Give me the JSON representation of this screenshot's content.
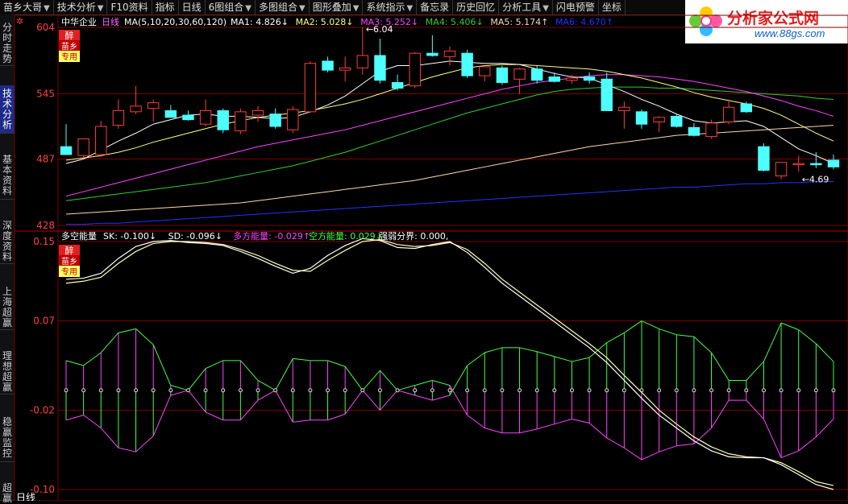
{
  "menu": [
    "苗乡大哥",
    "技术分析",
    "F10资料",
    "指标",
    "日线",
    "6图组合",
    "多图组合",
    "图形叠加",
    "系统指示",
    "备忘录",
    "历史回忆",
    "分析工具",
    "闪电预警",
    "坐标"
  ],
  "menu_arrows": [
    true,
    true,
    false,
    false,
    false,
    true,
    true,
    true,
    true,
    false,
    false,
    true,
    false,
    false
  ],
  "logo": {
    "brand": "分析家公式网",
    "url": "www.88gs.com"
  },
  "sidebar": [
    {
      "label": "分时走势",
      "active": false
    },
    {
      "label": "技术分析",
      "active": true
    },
    {
      "label": "基本资料",
      "active": false
    },
    {
      "label": "深度资料",
      "active": false
    },
    {
      "label": "上海超赢",
      "active": false
    },
    {
      "label": "理想超赢",
      "active": false
    },
    {
      "label": "稳赢监控",
      "active": false
    },
    {
      "label": "超赢",
      "active": false
    }
  ],
  "status_text": "日线",
  "badge": {
    "line1": "醉",
    "line2": "苗乡",
    "line3": "专用"
  },
  "colors": {
    "up": "#ff3c3c",
    "down": "#4dffff",
    "ma1": "#ffffff",
    "ma2": "#ffff80",
    "ma3": "#ff44ff",
    "ma4": "#33cc33",
    "ma5": "#ffd8b0",
    "ma6": "#2233ff",
    "pink": "#ff44ff",
    "green": "#44ff44",
    "grid": "#7a0000"
  },
  "chart_data": [
    {
      "type": "candlestick",
      "title": "中华企业",
      "period": "日线",
      "indicator_label": "MA(5,10,20,30,60,120)",
      "legend": [
        {
          "text": "MA1: 4.826",
          "arrow": "↓",
          "color": "ma1"
        },
        {
          "text": "MA2: 5.028",
          "arrow": "↓",
          "color": "ma2"
        },
        {
          "text": "MA3: 5.252",
          "arrow": "↓",
          "color": "ma3"
        },
        {
          "text": "MA4: 5.406",
          "arrow": "↓",
          "color": "ma4"
        },
        {
          "text": "MA5: 5.174",
          "arrow": "↑",
          "color": "ma5"
        },
        {
          "text": "MA6: 4.670",
          "arrow": "↑",
          "color": "ma6"
        }
      ],
      "y_ticks": [
        "604",
        "545",
        "487",
        "428"
      ],
      "y_values": [
        6.04,
        5.45,
        4.87,
        4.28
      ],
      "ylim": [
        4.28,
        6.04
      ],
      "annotations": [
        {
          "text": "6.04",
          "x": 17,
          "y": 6.04
        },
        {
          "text": "4.69",
          "x": 42,
          "y": 4.69
        }
      ],
      "candles": [
        {
          "o": 4.98,
          "h": 5.18,
          "l": 4.93,
          "c": 4.91
        },
        {
          "o": 4.9,
          "h": 5.03,
          "l": 4.88,
          "c": 5.05
        },
        {
          "o": 4.91,
          "h": 5.21,
          "l": 4.89,
          "c": 5.16
        },
        {
          "o": 5.17,
          "h": 5.4,
          "l": 5.14,
          "c": 5.3
        },
        {
          "o": 5.29,
          "h": 5.52,
          "l": 5.27,
          "c": 5.34
        },
        {
          "o": 5.32,
          "h": 5.4,
          "l": 5.2,
          "c": 5.37
        },
        {
          "o": 5.3,
          "h": 5.35,
          "l": 5.24,
          "c": 5.24
        },
        {
          "o": 5.26,
          "h": 5.3,
          "l": 5.21,
          "c": 5.22
        },
        {
          "o": 5.18,
          "h": 5.4,
          "l": 5.16,
          "c": 5.3
        },
        {
          "o": 5.3,
          "h": 5.32,
          "l": 5.1,
          "c": 5.13
        },
        {
          "o": 5.12,
          "h": 5.32,
          "l": 5.09,
          "c": 5.29
        },
        {
          "o": 5.26,
          "h": 5.34,
          "l": 5.2,
          "c": 5.3
        },
        {
          "o": 5.27,
          "h": 5.32,
          "l": 5.14,
          "c": 5.16
        },
        {
          "o": 5.13,
          "h": 5.34,
          "l": 5.1,
          "c": 5.31
        },
        {
          "o": 5.29,
          "h": 5.74,
          "l": 5.28,
          "c": 5.72
        },
        {
          "o": 5.74,
          "h": 5.78,
          "l": 5.64,
          "c": 5.66
        },
        {
          "o": 5.66,
          "h": 5.78,
          "l": 5.56,
          "c": 5.68
        },
        {
          "o": 5.68,
          "h": 6.04,
          "l": 5.62,
          "c": 5.79
        },
        {
          "o": 5.79,
          "h": 5.94,
          "l": 5.54,
          "c": 5.57
        },
        {
          "o": 5.55,
          "h": 5.62,
          "l": 5.48,
          "c": 5.5
        },
        {
          "o": 5.52,
          "h": 5.82,
          "l": 5.5,
          "c": 5.81
        },
        {
          "o": 5.81,
          "h": 5.97,
          "l": 5.78,
          "c": 5.79
        },
        {
          "o": 5.78,
          "h": 5.87,
          "l": 5.7,
          "c": 5.83
        },
        {
          "o": 5.81,
          "h": 5.84,
          "l": 5.59,
          "c": 5.61
        },
        {
          "o": 5.61,
          "h": 5.7,
          "l": 5.56,
          "c": 5.69
        },
        {
          "o": 5.68,
          "h": 5.7,
          "l": 5.53,
          "c": 5.55
        },
        {
          "o": 5.58,
          "h": 5.68,
          "l": 5.45,
          "c": 5.67
        },
        {
          "o": 5.67,
          "h": 5.7,
          "l": 5.54,
          "c": 5.57
        },
        {
          "o": 5.6,
          "h": 5.64,
          "l": 5.55,
          "c": 5.56
        },
        {
          "o": 5.57,
          "h": 5.62,
          "l": 5.54,
          "c": 5.59
        },
        {
          "o": 5.6,
          "h": 5.64,
          "l": 5.54,
          "c": 5.57
        },
        {
          "o": 5.58,
          "h": 5.64,
          "l": 5.34,
          "c": 5.3
        },
        {
          "o": 5.3,
          "h": 5.38,
          "l": 5.14,
          "c": 5.33
        },
        {
          "o": 5.29,
          "h": 5.31,
          "l": 5.14,
          "c": 5.18
        },
        {
          "o": 5.2,
          "h": 5.25,
          "l": 5.11,
          "c": 5.24
        },
        {
          "o": 5.25,
          "h": 5.27,
          "l": 5.15,
          "c": 5.16
        },
        {
          "o": 5.15,
          "h": 5.19,
          "l": 5.07,
          "c": 5.08
        },
        {
          "o": 5.07,
          "h": 5.22,
          "l": 5.05,
          "c": 5.19
        },
        {
          "o": 5.2,
          "h": 5.4,
          "l": 5.18,
          "c": 5.33
        },
        {
          "o": 5.36,
          "h": 5.38,
          "l": 5.28,
          "c": 5.29
        },
        {
          "o": 4.98,
          "h": 5.01,
          "l": 4.76,
          "c": 4.77
        },
        {
          "o": 4.72,
          "h": 4.83,
          "l": 4.69,
          "c": 4.84
        },
        {
          "o": 4.82,
          "h": 4.9,
          "l": 4.76,
          "c": 4.83
        },
        {
          "o": 4.83,
          "h": 4.93,
          "l": 4.79,
          "c": 4.82
        },
        {
          "o": 4.86,
          "h": 4.91,
          "l": 4.78,
          "c": 4.8
        }
      ],
      "ma": {
        "ma1": [
          4.83,
          4.87,
          4.95,
          5.03,
          5.1,
          5.18,
          5.22,
          5.26,
          5.27,
          5.25,
          5.25,
          5.24,
          5.23,
          5.24,
          5.29,
          5.35,
          5.43,
          5.54,
          5.65,
          5.7,
          5.7,
          5.72,
          5.74,
          5.73,
          5.72,
          5.72,
          5.71,
          5.67,
          5.63,
          5.6,
          5.59,
          5.53,
          5.47,
          5.4,
          5.34,
          5.27,
          5.21,
          5.19,
          5.2,
          5.21,
          5.16,
          5.06,
          4.96,
          4.9,
          4.83
        ],
        "ma2": [
          4.86,
          4.88,
          4.9,
          4.93,
          4.97,
          5.02,
          5.06,
          5.1,
          5.14,
          5.18,
          5.21,
          5.24,
          5.26,
          5.28,
          5.3,
          5.33,
          5.36,
          5.4,
          5.45,
          5.5,
          5.55,
          5.6,
          5.64,
          5.68,
          5.7,
          5.71,
          5.71,
          5.7,
          5.69,
          5.68,
          5.67,
          5.65,
          5.62,
          5.59,
          5.55,
          5.51,
          5.46,
          5.42,
          5.39,
          5.36,
          5.32,
          5.26,
          5.18,
          5.1,
          5.03
        ],
        "ma3": [
          4.54,
          4.58,
          4.62,
          4.66,
          4.7,
          4.74,
          4.78,
          4.82,
          4.86,
          4.9,
          4.94,
          4.98,
          5.01,
          5.04,
          5.07,
          5.1,
          5.13,
          5.17,
          5.21,
          5.25,
          5.29,
          5.33,
          5.37,
          5.41,
          5.45,
          5.49,
          5.52,
          5.55,
          5.57,
          5.59,
          5.61,
          5.62,
          5.62,
          5.61,
          5.6,
          5.58,
          5.56,
          5.53,
          5.5,
          5.47,
          5.43,
          5.39,
          5.34,
          5.3,
          5.25
        ],
        "ma4": [
          4.5,
          4.52,
          4.54,
          4.56,
          4.58,
          4.6,
          4.62,
          4.64,
          4.66,
          4.69,
          4.72,
          4.75,
          4.78,
          4.81,
          4.85,
          4.89,
          4.93,
          4.98,
          5.03,
          5.08,
          5.13,
          5.18,
          5.23,
          5.28,
          5.32,
          5.36,
          5.4,
          5.44,
          5.47,
          5.49,
          5.5,
          5.51,
          5.51,
          5.51,
          5.5,
          5.5,
          5.49,
          5.48,
          5.47,
          5.46,
          5.45,
          5.44,
          5.43,
          5.41,
          5.4
        ],
        "ma5": [
          4.38,
          4.39,
          4.4,
          4.41,
          4.42,
          4.43,
          4.44,
          4.45,
          4.46,
          4.47,
          4.48,
          4.5,
          4.52,
          4.54,
          4.56,
          4.58,
          4.6,
          4.62,
          4.64,
          4.66,
          4.68,
          4.71,
          4.74,
          4.77,
          4.8,
          4.83,
          4.86,
          4.89,
          4.92,
          4.95,
          4.98,
          5.0,
          5.02,
          5.04,
          5.06,
          5.08,
          5.09,
          5.1,
          5.11,
          5.12,
          5.13,
          5.14,
          5.15,
          5.16,
          5.17
        ],
        "ma6": [
          4.29,
          4.29,
          4.3,
          4.3,
          4.31,
          4.32,
          4.33,
          4.34,
          4.35,
          4.36,
          4.37,
          4.38,
          4.39,
          4.4,
          4.41,
          4.42,
          4.43,
          4.44,
          4.45,
          4.46,
          4.47,
          4.48,
          4.49,
          4.5,
          4.51,
          4.52,
          4.53,
          4.54,
          4.55,
          4.56,
          4.57,
          4.58,
          4.59,
          4.6,
          4.61,
          4.62,
          4.62,
          4.63,
          4.64,
          4.65,
          4.65,
          4.66,
          4.66,
          4.67,
          4.67
        ]
      }
    },
    {
      "type": "line",
      "title": "多空能量",
      "legend": [
        {
          "text": "SK: -0.100",
          "arrow": "↓",
          "color": "ma1"
        },
        {
          "text": "SD: -0.096",
          "arrow": "↓",
          "color": "ma1"
        },
        {
          "text": "多方能量: -0.029",
          "arrow": "↑",
          "color": "pink"
        },
        {
          "text": "空方能量: 0.029",
          "arrow": "↓",
          "color": "green"
        },
        {
          "text": "强弱分界: 0.000,",
          "arrow": "",
          "color": "ma1"
        }
      ],
      "y_ticks": [
        "0.15",
        "0.07",
        "-0.02",
        "-0.10"
      ],
      "y_values": [
        0.15,
        0.07,
        -0.02,
        -0.1
      ],
      "ylim": [
        -0.1,
        0.15
      ],
      "sk": [
        0.112,
        0.113,
        0.118,
        0.133,
        0.145,
        0.15,
        0.151,
        0.149,
        0.148,
        0.146,
        0.14,
        0.133,
        0.125,
        0.118,
        0.123,
        0.136,
        0.146,
        0.153,
        0.151,
        0.144,
        0.143,
        0.147,
        0.15,
        0.139,
        0.124,
        0.108,
        0.095,
        0.082,
        0.069,
        0.056,
        0.043,
        0.028,
        0.01,
        -0.008,
        -0.025,
        -0.038,
        -0.051,
        -0.061,
        -0.067,
        -0.068,
        -0.068,
        -0.075,
        -0.085,
        -0.095,
        -0.1
      ],
      "sd": [
        0.108,
        0.11,
        0.114,
        0.128,
        0.14,
        0.148,
        0.15,
        0.15,
        0.149,
        0.147,
        0.142,
        0.136,
        0.128,
        0.121,
        0.12,
        0.131,
        0.141,
        0.15,
        0.152,
        0.147,
        0.145,
        0.146,
        0.149,
        0.142,
        0.128,
        0.112,
        0.099,
        0.086,
        0.073,
        0.06,
        0.047,
        0.033,
        0.015,
        -0.002,
        -0.02,
        -0.034,
        -0.047,
        -0.057,
        -0.064,
        -0.067,
        -0.068,
        -0.073,
        -0.082,
        -0.092,
        -0.096
      ],
      "bull": [
        0.03,
        0.025,
        0.038,
        0.058,
        0.062,
        0.046,
        0.005,
        0.0,
        0.022,
        0.03,
        0.03,
        0.01,
        0.0,
        0.032,
        0.03,
        0.03,
        0.024,
        0.0,
        0.02,
        0.0,
        0.005,
        0.01,
        0.005,
        -0.025,
        -0.038,
        -0.043,
        -0.043,
        -0.039,
        -0.034,
        -0.029,
        -0.033,
        -0.048,
        -0.058,
        -0.07,
        -0.062,
        -0.056,
        -0.054,
        -0.038,
        -0.01,
        -0.01,
        -0.029,
        -0.068,
        -0.061,
        -0.047,
        -0.029
      ],
      "bear": [
        -0.03,
        -0.025,
        -0.038,
        -0.058,
        -0.062,
        -0.046,
        -0.005,
        0.0,
        -0.022,
        -0.03,
        -0.03,
        -0.01,
        0.0,
        -0.032,
        -0.03,
        -0.03,
        -0.024,
        0.0,
        -0.02,
        0.0,
        -0.005,
        -0.01,
        -0.005,
        0.025,
        0.038,
        0.043,
        0.043,
        0.039,
        0.034,
        0.029,
        0.033,
        0.048,
        0.058,
        0.07,
        0.062,
        0.056,
        0.054,
        0.038,
        0.01,
        0.01,
        0.029,
        0.068,
        0.061,
        0.047,
        0.029
      ]
    }
  ]
}
